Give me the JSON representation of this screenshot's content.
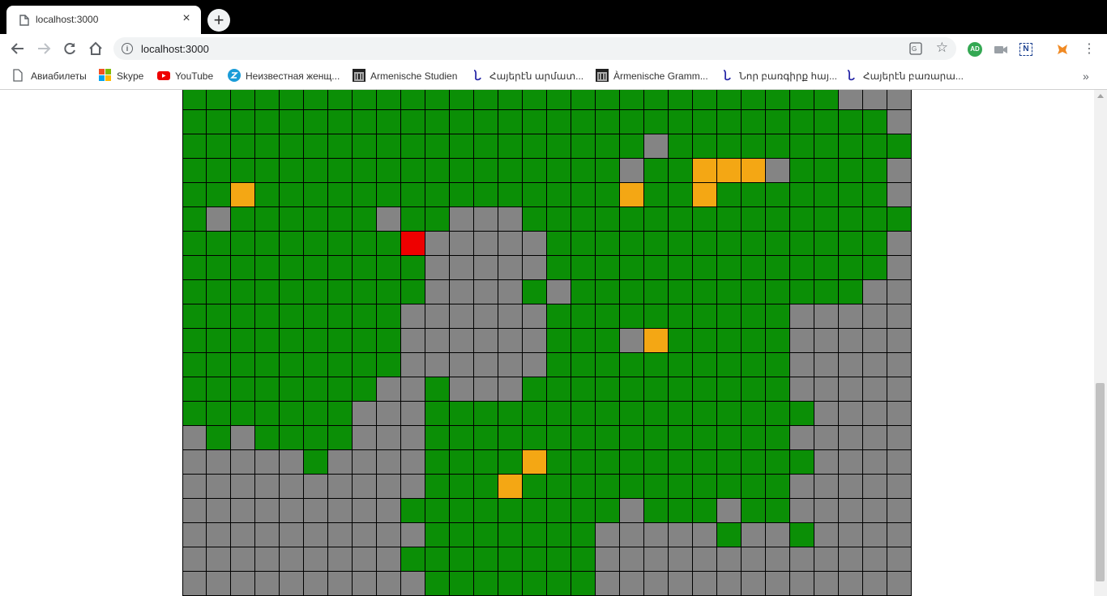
{
  "browser": {
    "tab_title": "localhost:3000",
    "new_tab_label": "+",
    "tab_close_label": "×",
    "url": "localhost:3000",
    "menu_label": "⋮",
    "extensions": {
      "ad_label": "AD",
      "n_label": "N"
    },
    "bookmarks": [
      {
        "label": "Авиабилеты",
        "icon": "page-icon"
      },
      {
        "label": "Skype",
        "icon": "microsoft-icon"
      },
      {
        "label": "YouTube",
        "icon": "youtube-icon"
      },
      {
        "label": "Неизвестная женщ...",
        "icon": "zen-icon"
      },
      {
        "label": "Armenische Studien",
        "icon": "museum-icon"
      },
      {
        "label": "Հայերէն արմատ...",
        "icon": "armenian-letter-icon"
      },
      {
        "label": "Àrmenische Gramm...",
        "icon": "museum-icon"
      },
      {
        "label": "Նոր բառգիրք հայ...",
        "icon": "armenian-letter-icon"
      },
      {
        "label": "Հայերէն բառարա...",
        "icon": "armenian-letter-icon"
      }
    ],
    "bookmarks_more": "»"
  },
  "colors": {
    "grass": "#0b8f06",
    "stone": "#848484",
    "gold": "#f4a714",
    "player": "#ee0000"
  },
  "board": {
    "legend": {
      "G": "grass",
      "S": "stone",
      "O": "gold",
      "R": "player"
    },
    "rows": [
      "GGGGGGGGGGGGGGGGGGGGGGGGGGGSSS",
      "GGGGGGGGGGGGGGGGGGGGGGGGGGGGGS",
      "GGGGGGGGGGGGGGGGGGGSGGGGGGGGGG",
      "GGGGGGGGGGGGGGGGGGSGGOOOSGGGGS",
      "GGOGGGGGGGGGGGGGGGOGGOGGGGGGGS",
      "GSGGGGGGSGGSSSGGGGGGGGGGGGGGGG",
      "GGGGGGGGGRSSSSSGGGGGGGGGGGGGGS",
      "GGGGGGGGGGSSSSSGGGGGGGGGGGGGGS",
      "GGGGGGGGGGSSSSGSGGGGGGGGGGGGSS",
      "GGGGGGGGGSSSSSSGGGGGGGGGGSSSSS",
      "GGGGGGGGGSSSSSSGGGSOGGGGGSSSSS",
      "GGGGGGGGGSSSSSSGGGGGGGGGGSSSSS",
      "GGGGGGGGSSGSSSGGGGGGGGGGGSSSSS",
      "GGGGGGGSSSGGGGGGGGGGGGGGGGSSSS",
      "SGSGGGGSSSGGGGGGGGGGGGGGGSSSSS",
      "SSSSSGSSSSGGGGOGGGGGGGGGGGSSSS",
      "SSSSSSSSSSGGGOGGGGGGGGGGGSSSSS",
      "SSSSSSSSSGGGGGGGGGSGGGSGGSSSSS",
      "SSSSSSSSSSGGGGGGGSSSSSGSSGSSSS",
      "SSSSSSSSSGGGGGGGGSSSSSSSSSSSSS",
      "SSSSSSSSSSGGGGGGGSSSSSSSSSSSSS"
    ]
  }
}
